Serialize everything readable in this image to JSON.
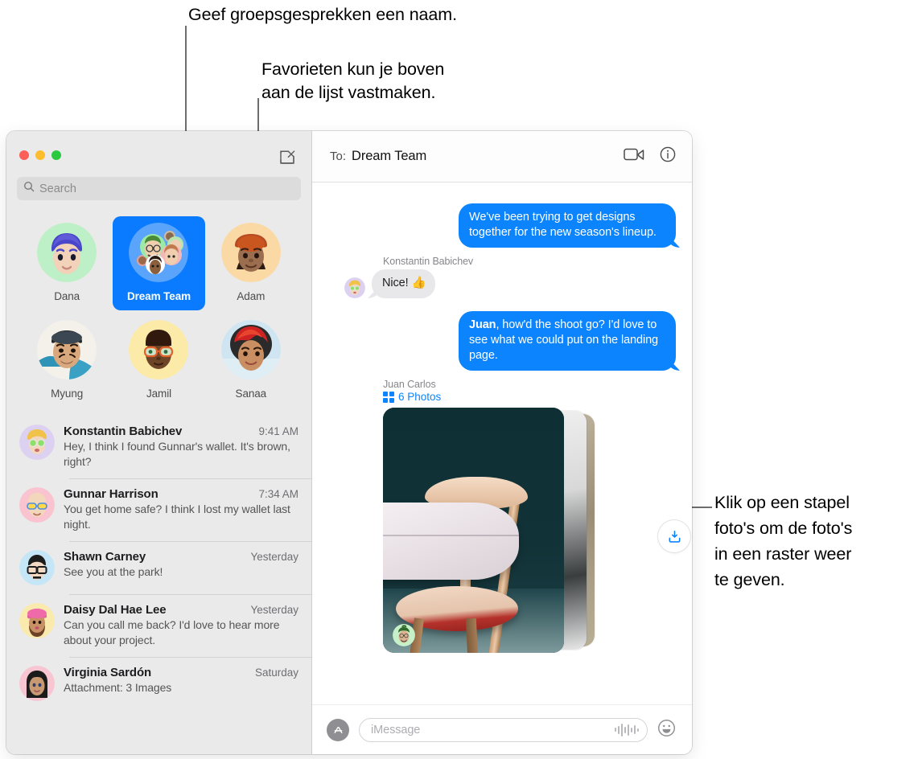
{
  "callouts": [
    {
      "id": "c1",
      "text": "Geef groepsgesprekken een naam."
    },
    {
      "id": "c2",
      "text": "Favorieten kun je boven\naan de lijst vastmaken."
    },
    {
      "id": "c3",
      "text": "Klik op een stapel\nfoto's om de foto's\nin een raster weer\nte geven."
    }
  ],
  "window": {
    "traffic_lights": {
      "close": "close-button",
      "minimize": "minimize-button",
      "zoom": "zoom-button"
    },
    "compose_icon": "compose-icon"
  },
  "sidebar": {
    "search": {
      "placeholder": "Search",
      "icon": "search-icon"
    },
    "favorites": [
      {
        "label": "Dana",
        "selected": false
      },
      {
        "label": "Dream Team",
        "selected": true
      },
      {
        "label": "Adam",
        "selected": false
      },
      {
        "label": "Myung",
        "selected": false
      },
      {
        "label": "Jamil",
        "selected": false
      },
      {
        "label": "Sanaa",
        "selected": false
      }
    ],
    "conversations": [
      {
        "name": "Konstantin Babichev",
        "time": "9:41 AM",
        "snippet": "Hey, I think I found Gunnar's wallet. It's brown, right?"
      },
      {
        "name": "Gunnar Harrison",
        "time": "7:34 AM",
        "snippet": "You get home safe? I think I lost my wallet last night."
      },
      {
        "name": "Shawn Carney",
        "time": "Yesterday",
        "snippet": "See you at the park!"
      },
      {
        "name": "Daisy Dal Hae Lee",
        "time": "Yesterday",
        "snippet": "Can you call me back? I'd love to hear more about your project."
      },
      {
        "name": "Virginia Sardón",
        "time": "Saturday",
        "snippet": "Attachment: 3 Images"
      }
    ]
  },
  "conversation": {
    "header": {
      "to_label": "To:",
      "to_value": "Dream Team",
      "facetime_icon": "video-camera-icon",
      "info_icon": "info-icon"
    },
    "messages": [
      {
        "kind": "outgoing",
        "text": "We've been trying to get designs together for the new season's lineup."
      },
      {
        "kind": "incoming",
        "sender": "Konstantin Babichev",
        "text": "Nice!  👍"
      },
      {
        "kind": "outgoing",
        "text_bold": "Juan",
        "text": ", how'd the shoot go? I'd love to see what we could put on the landing page."
      }
    ],
    "photo_stack": {
      "sender": "Juan Carlos",
      "count_label": "6 Photos",
      "grid_icon": "grid-2x2-icon",
      "download_icon": "download-icon",
      "avatar": "juan-avatar"
    },
    "composer": {
      "apps_icon": "app-store-icon",
      "placeholder": "iMessage",
      "audio_icon": "audio-waveform-icon",
      "emoji_icon": "emoji-smiley-icon"
    }
  },
  "colors": {
    "accent_blue": "#0b84fe",
    "selected_blue": "#0a7bff",
    "bubble_gray": "#e8e8ea",
    "sidebar_bg": "#eaeaea",
    "traffic_red": "#fc6058",
    "traffic_yellow": "#fdbd2e",
    "traffic_green": "#2bc940"
  }
}
